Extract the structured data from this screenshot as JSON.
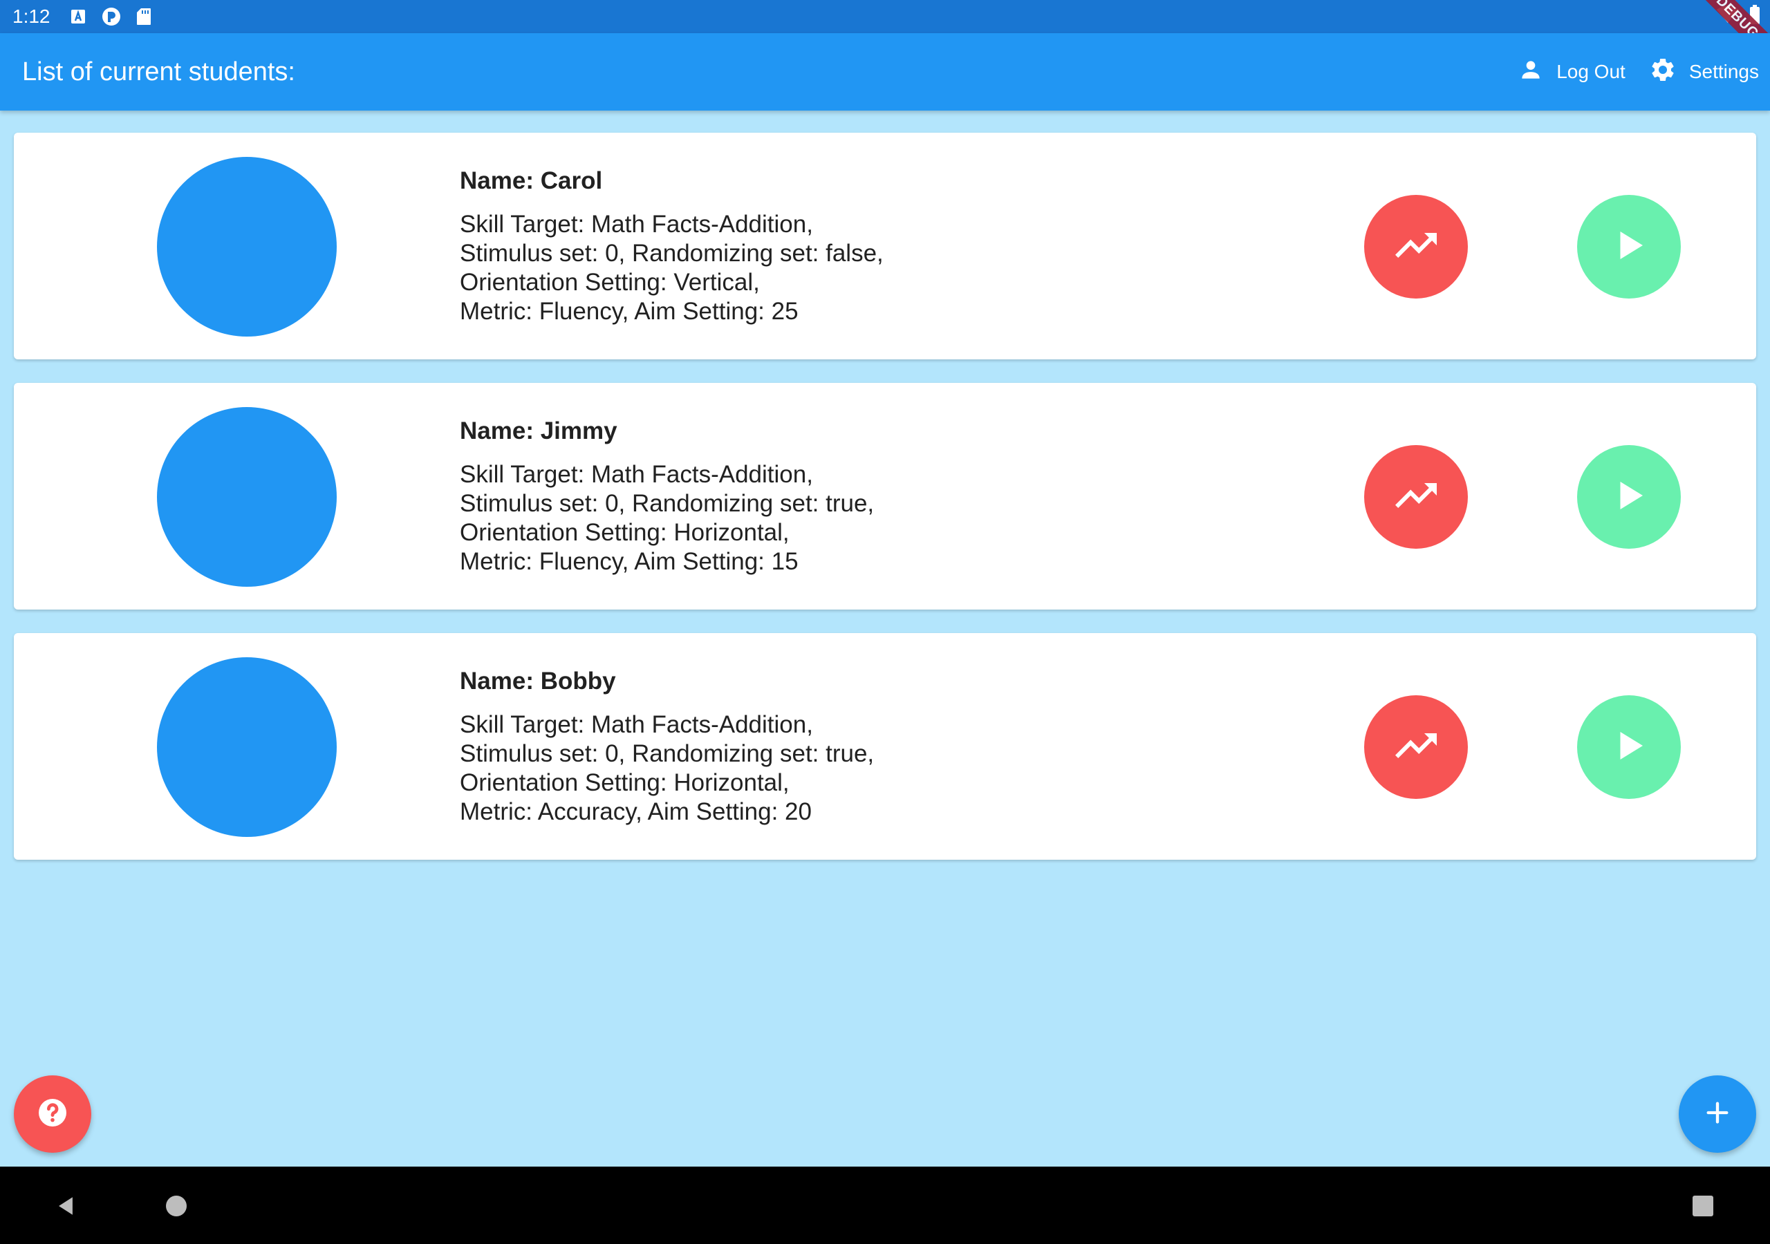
{
  "status_bar": {
    "time": "1:12",
    "icons": [
      "a-icon",
      "p-icon",
      "sd-card-icon"
    ],
    "right_icons": [
      "wifi-icon",
      "battery-icon"
    ],
    "debug_label": "DEBUG"
  },
  "app_bar": {
    "title": "List of current students:",
    "logout_label": "Log Out",
    "settings_label": "Settings"
  },
  "students": [
    {
      "name": "Name: Carol",
      "line1": "Skill Target: Math Facts-Addition,",
      "line2": "Stimulus set: 0, Randomizing set: false,",
      "line3": "Orientation Setting: Vertical,",
      "line4": "Metric: Fluency, Aim Setting: 25"
    },
    {
      "name": "Name: Jimmy",
      "line1": "Skill Target: Math Facts-Addition,",
      "line2": "Stimulus set: 0, Randomizing set: true,",
      "line3": "Orientation Setting: Horizontal,",
      "line4": "Metric: Fluency, Aim Setting: 15"
    },
    {
      "name": "Name: Bobby",
      "line1": "Skill Target: Math Facts-Addition,",
      "line2": "Stimulus set: 0, Randomizing set: true,",
      "line3": "Orientation Setting: Horizontal,",
      "line4": "Metric: Accuracy, Aim Setting: 20"
    }
  ],
  "colors": {
    "primary": "#2196F3",
    "status_bar": "#1976D2",
    "background": "#B3E5FC",
    "chart_button": "#F75454",
    "play_button": "#69F0AE"
  }
}
